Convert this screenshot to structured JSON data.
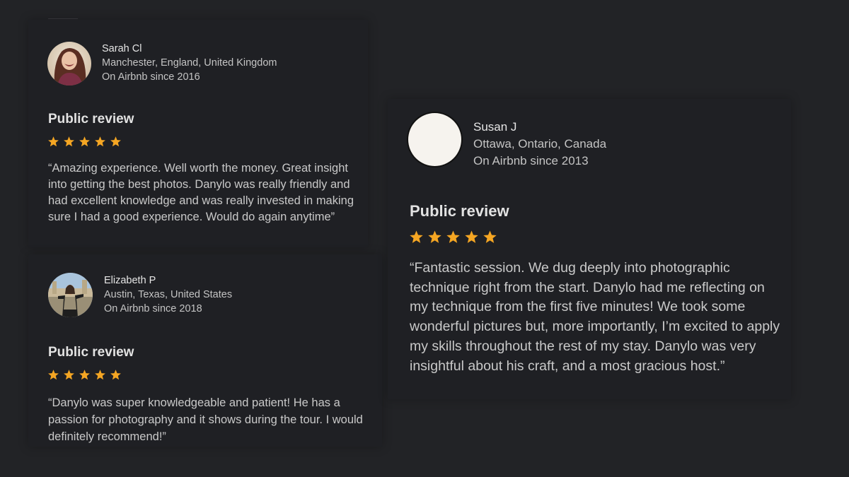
{
  "colors": {
    "background": "#222326",
    "card": "#1f2024",
    "star": "#f5a623",
    "text_primary": "#e6e6e6",
    "text_secondary": "#c4c4c4"
  },
  "reviews": [
    {
      "user": {
        "name": "Sarah Cl",
        "location": "Manchester, England, United Kingdom",
        "since": "On Airbnb since 2016",
        "avatar_icon": "user-photo"
      },
      "section_title": "Public review",
      "rating": 5,
      "text": "“Amazing experience. Well worth the money. Great insight into getting the best photos. Danylo was really friendly and had excellent knowledge and was really invested in making sure I had a good experience. Would do again anytime”"
    },
    {
      "user": {
        "name": "Elizabeth P",
        "location": "Austin, Texas, United States",
        "since": "On Airbnb since 2018",
        "avatar_icon": "user-photo"
      },
      "section_title": "Public review",
      "rating": 5,
      "text": "“Danylo was super knowledgeable and patient! He has a passion for photography and it shows during the tour. I would definitely recommend!”"
    },
    {
      "user": {
        "name": "Susan J",
        "location": "Ottawa, Ontario, Canada",
        "since": "On Airbnb since 2013",
        "avatar_icon": "blank-avatar"
      },
      "section_title": "Public review",
      "rating": 5,
      "text": "“Fantastic session. We dug deeply into photographic technique right from the start. Danylo had me reflecting on my technique from the first five minutes! We took some wonderful pictures but, more importantly, I’m excited to apply my skills throughout the rest of my stay. Danylo was very insightful about his craft, and a most gracious host.”"
    }
  ]
}
